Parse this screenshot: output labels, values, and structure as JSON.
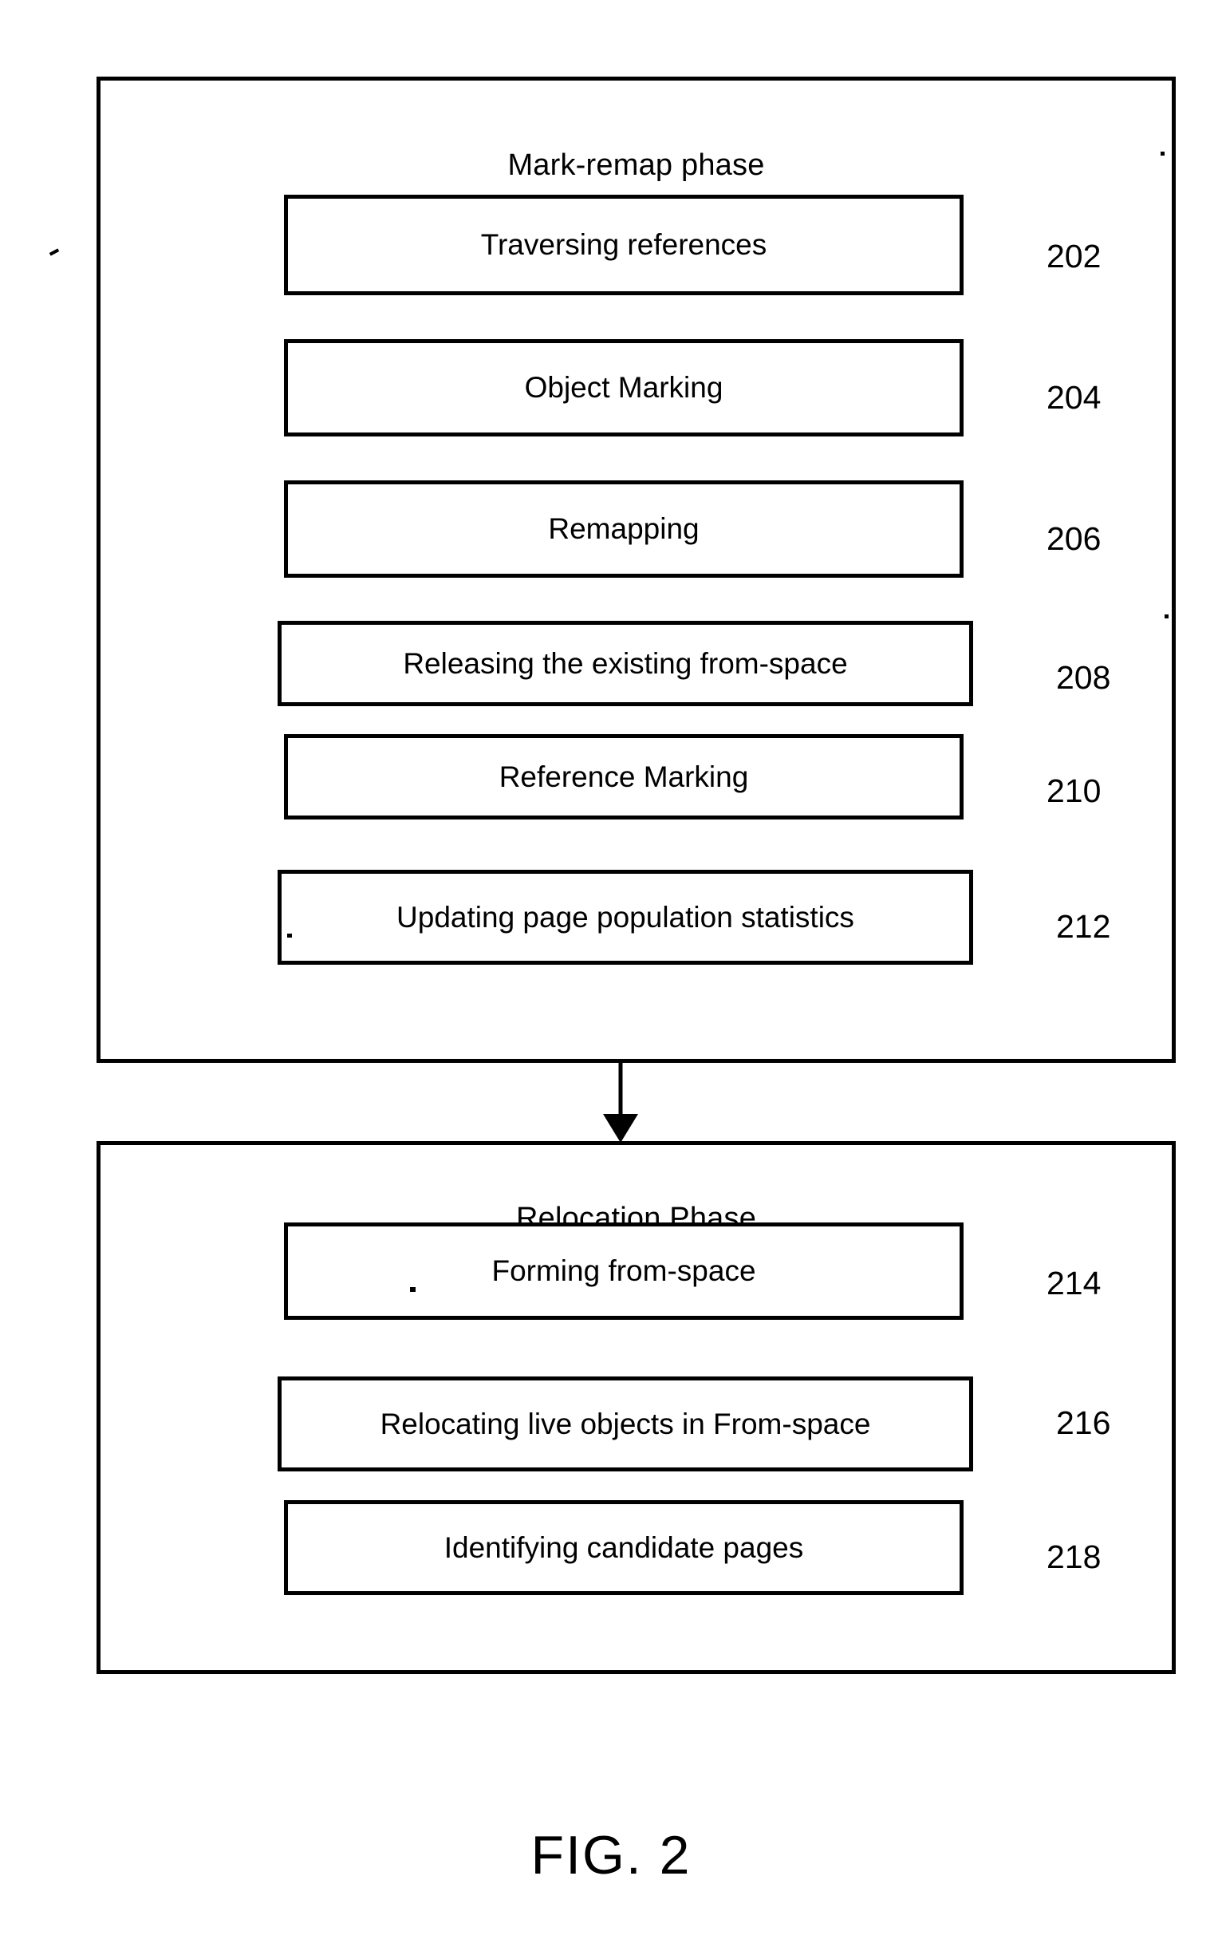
{
  "figure": {
    "caption": "FIG. 2"
  },
  "phases": [
    {
      "id": "mark-remap",
      "title": "Mark-remap phase",
      "steps": [
        {
          "label": "Traversing references",
          "ref": "202"
        },
        {
          "label": "Object Marking",
          "ref": "204"
        },
        {
          "label": "Remapping",
          "ref": "206"
        },
        {
          "label": "Releasing the existing from-space",
          "ref": "208"
        },
        {
          "label": "Reference Marking",
          "ref": "210"
        },
        {
          "label": "Updating page population statistics",
          "ref": "212"
        }
      ]
    },
    {
      "id": "relocation",
      "title": "Relocation Phase",
      "steps": [
        {
          "label": "Forming from-space",
          "ref": "214"
        },
        {
          "label": "Relocating live objects in From-space",
          "ref": "216"
        },
        {
          "label": "Identifying candidate pages",
          "ref": "218"
        }
      ]
    }
  ],
  "colors": {
    "ink": "#000000",
    "background": "#ffffff"
  }
}
